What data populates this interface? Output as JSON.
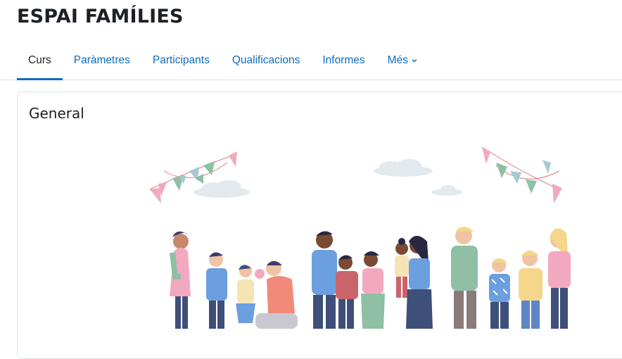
{
  "course": {
    "title": "ESPAI FAMÍLIES"
  },
  "nav": {
    "tabs": [
      {
        "label": "Curs",
        "active": true
      },
      {
        "label": "Paràmetres"
      },
      {
        "label": "Participants"
      },
      {
        "label": "Qualificacions"
      },
      {
        "label": "Informes"
      },
      {
        "label": "Més",
        "icon": "chevron-down-icon"
      }
    ]
  },
  "section": {
    "title": "General"
  },
  "colors": {
    "accent": "#0f6cbf",
    "text": "#1d2125",
    "border": "#dee2e6"
  }
}
